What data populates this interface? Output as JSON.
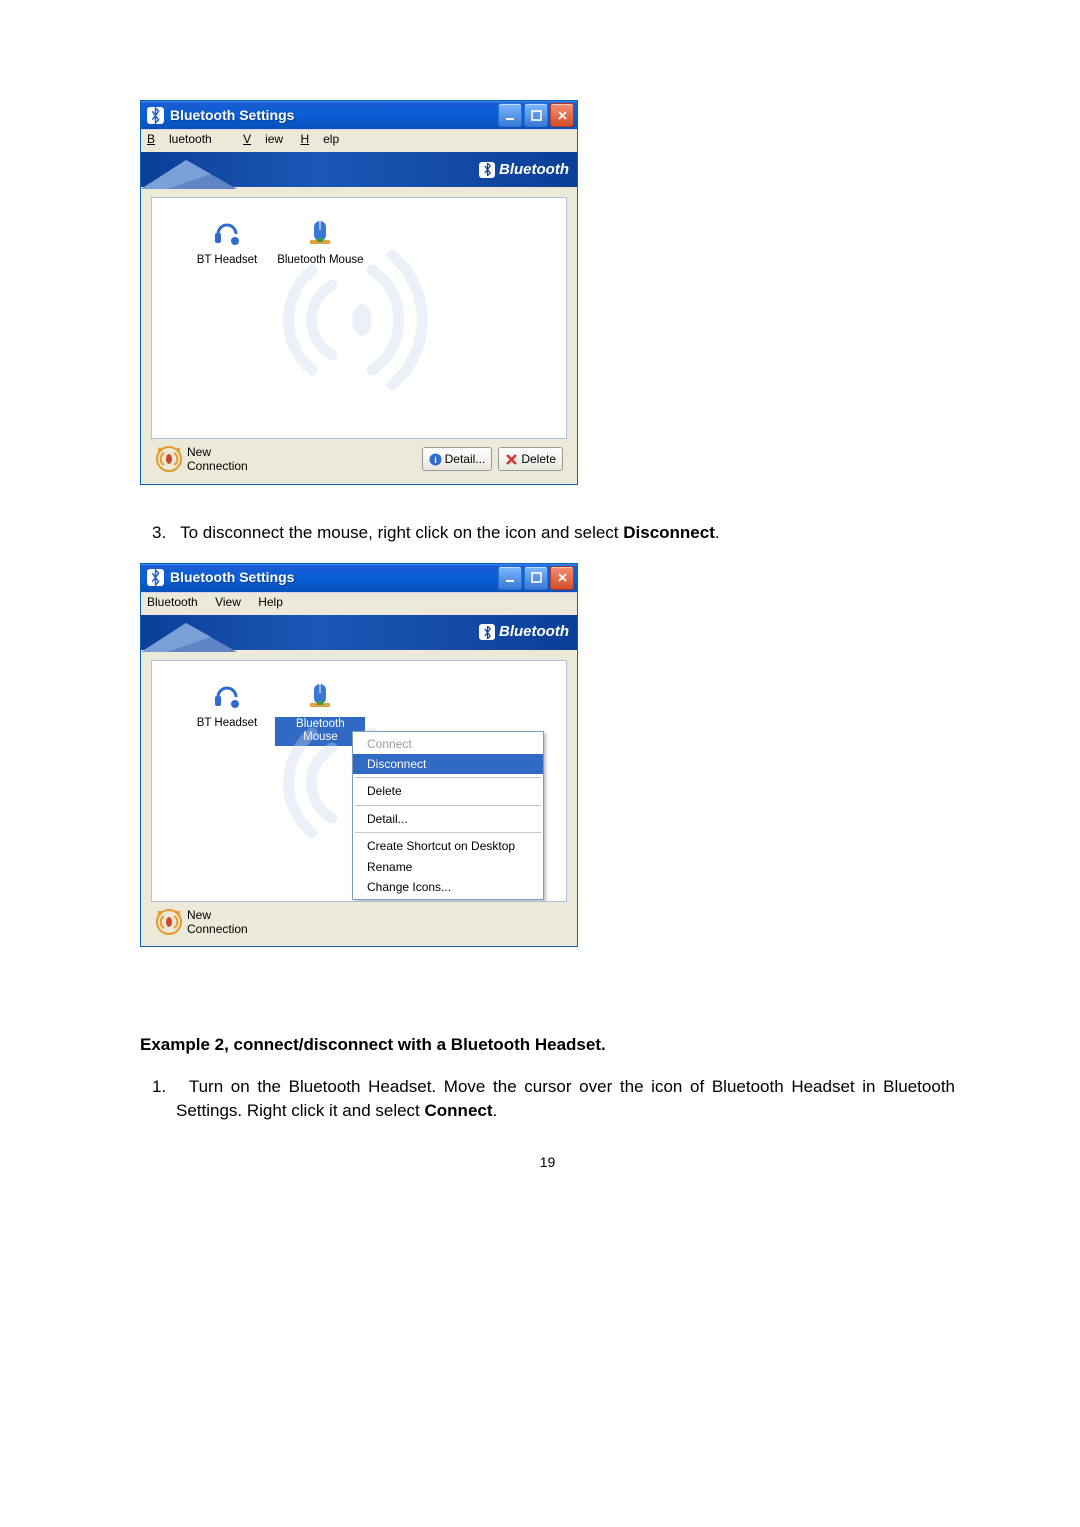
{
  "window1": {
    "title": "Bluetooth Settings",
    "menu": {
      "bluetooth": "Bluetooth",
      "view": "View",
      "help": "Help"
    },
    "banner": "Bluetooth",
    "devices": [
      {
        "label": "BT Headset"
      },
      {
        "label": "Bluetooth Mouse"
      }
    ],
    "toolbar": {
      "new_line1": "New",
      "new_line2": "Connection",
      "detail": "Detail...",
      "delete": "Delete"
    }
  },
  "step3": {
    "num": "3.",
    "prefix": "To disconnect the mouse, right click on the icon and select ",
    "bold": "Disconnect",
    "suffix": "."
  },
  "window2": {
    "title": "Bluetooth Settings",
    "menu": {
      "bluetooth": "Bluetooth",
      "view": "View",
      "help": "Help"
    },
    "banner": "Bluetooth",
    "devices": [
      {
        "label": "BT Headset"
      },
      {
        "label": "Bluetooth Mouse"
      }
    ],
    "context_menu": {
      "connect": "Connect",
      "disconnect": "Disconnect",
      "delete": "Delete",
      "detail": "Detail...",
      "shortcut": "Create Shortcut on Desktop",
      "rename": "Rename",
      "change_icons": "Change Icons..."
    },
    "toolbar": {
      "new_line1": "New",
      "new_line2": "Connection"
    }
  },
  "example2_heading": "Example 2, connect/disconnect with a Bluetooth Headset.",
  "example2_step1": {
    "num": "1.",
    "prefix": "Turn on the Bluetooth Headset. Move the cursor over the icon of Bluetooth Headset in Bluetooth Settings. Right click it and select ",
    "bold": "Connect",
    "suffix": "."
  },
  "page_number": "19"
}
